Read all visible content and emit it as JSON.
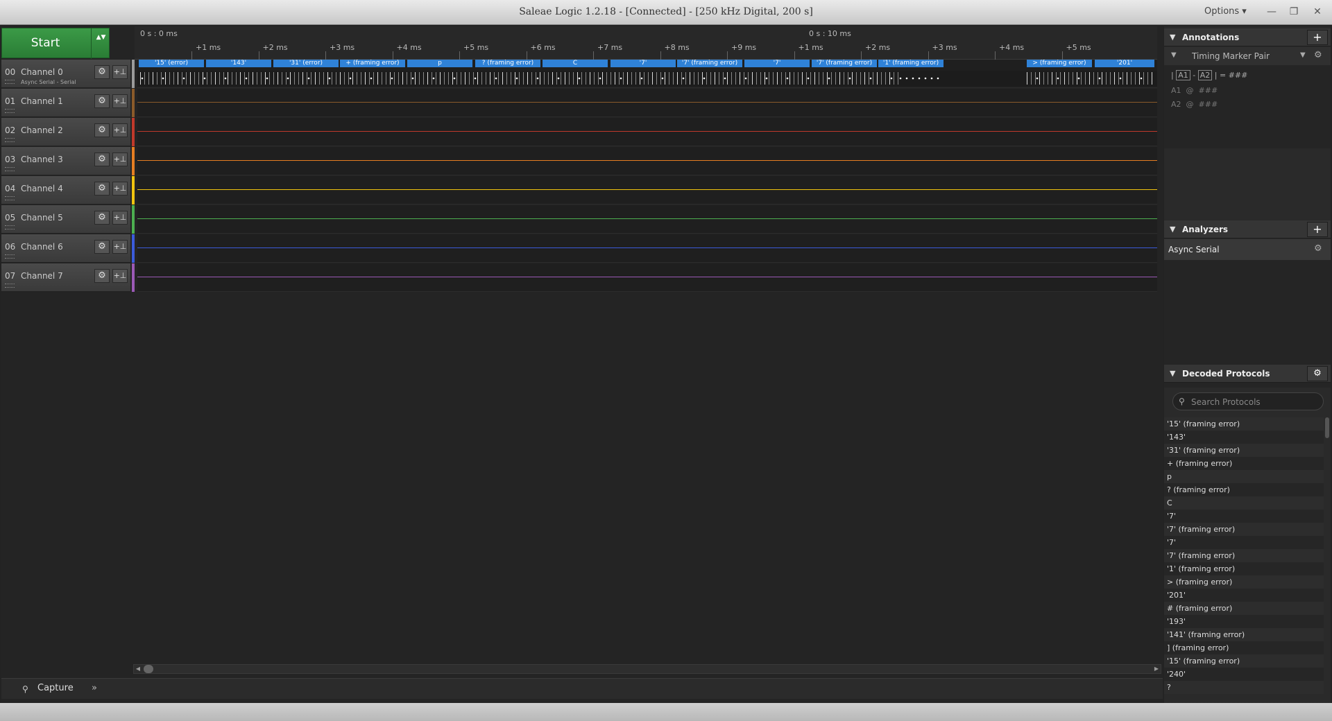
{
  "window": {
    "title": "Saleae Logic 1.2.18 - [Connected] - [250 kHz Digital, 200 s]",
    "options_label": "Options ▾",
    "minimize": "—",
    "restore": "❐",
    "close": "✕"
  },
  "start_button": {
    "label": "Start",
    "arrows": "▲▼"
  },
  "ruler": {
    "origin1": "0 s : 0 ms",
    "origin2": "0 s : 10 ms",
    "ticks": [
      "+1 ms",
      "+2 ms",
      "+3 ms",
      "+4 ms",
      "+5 ms",
      "+6 ms",
      "+7 ms",
      "+8 ms",
      "+9 ms",
      "+1 ms",
      "+2 ms",
      "+3 ms",
      "+4 ms",
      "+5 ms"
    ]
  },
  "channels": [
    {
      "num": "00",
      "name": "Channel 0",
      "sub": "Async Serial - Serial",
      "color": "#9a9a9a"
    },
    {
      "num": "01",
      "name": "Channel 1",
      "sub": "",
      "color": "#8a5a2a"
    },
    {
      "num": "02",
      "name": "Channel 2",
      "sub": "",
      "color": "#c0392b"
    },
    {
      "num": "03",
      "name": "Channel 3",
      "sub": "",
      "color": "#e67e22"
    },
    {
      "num": "04",
      "name": "Channel 4",
      "sub": "",
      "color": "#f1c40f"
    },
    {
      "num": "05",
      "name": "Channel 5",
      "sub": "",
      "color": "#4caf50"
    },
    {
      "num": "06",
      "name": "Channel 6",
      "sub": "",
      "color": "#3b5bdb"
    },
    {
      "num": "07",
      "name": "Channel 7",
      "sub": "",
      "color": "#9b59b6"
    }
  ],
  "channel_buttons": {
    "gear": "⚙",
    "plus": "+⊥"
  },
  "decoded_boxes": [
    "'15' (error)",
    "'143'",
    "'31' (error)",
    "+ (framing error)",
    "p",
    "? (framing error)",
    "C",
    "'7'",
    "'7' (framing error)",
    "'7'",
    "'7' (framing error)",
    "'1' (framing error)",
    "> (framing error)",
    "'201'"
  ],
  "capture": {
    "label": "Capture",
    "icon": "⚲",
    "chevron": "»"
  },
  "annotations": {
    "title": "Annotations",
    "add": "+",
    "marker_label": "Timing Marker Pair",
    "a1": "A1",
    "a2": "A2",
    "dash": "-",
    "bar": "|",
    "eq": "= ###",
    "a1_row": "A1  @  ###",
    "a2_row": "A2  @  ###"
  },
  "analyzers": {
    "title": "Analyzers",
    "add": "+",
    "item": "Async Serial"
  },
  "decoded_protocols": {
    "title": "Decoded Protocols",
    "search_placeholder": "Search Protocols",
    "search_icon": "magnifier-icon",
    "items": [
      "'15' (framing error)",
      "'143'",
      "'31' (framing error)",
      "+ (framing error)",
      "p",
      "? (framing error)",
      "C",
      "'7'",
      "'7' (framing error)",
      "'7'",
      "'7' (framing error)",
      "'1' (framing error)",
      "> (framing error)",
      "'201'",
      "# (framing error)",
      "'193'",
      "'141' (framing error)",
      "] (framing error)",
      "'15' (framing error)",
      "'240'",
      "?"
    ]
  }
}
